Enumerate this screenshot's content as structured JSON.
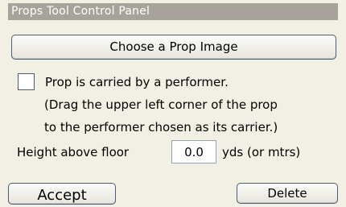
{
  "panel": {
    "title": "Props Tool Control Panel"
  },
  "buttons": {
    "choose_image": "Choose a Prop Image",
    "accept": "Accept",
    "delete": "Delete"
  },
  "carried": {
    "checked": false,
    "line1": "Prop is carried by a performer.",
    "line2": "(Drag the upper left corner of the prop",
    "line3": "to the performer chosen as its carrier.)"
  },
  "height": {
    "label": "Height above floor",
    "value": "0.0",
    "units": "yds (or mtrs)"
  }
}
